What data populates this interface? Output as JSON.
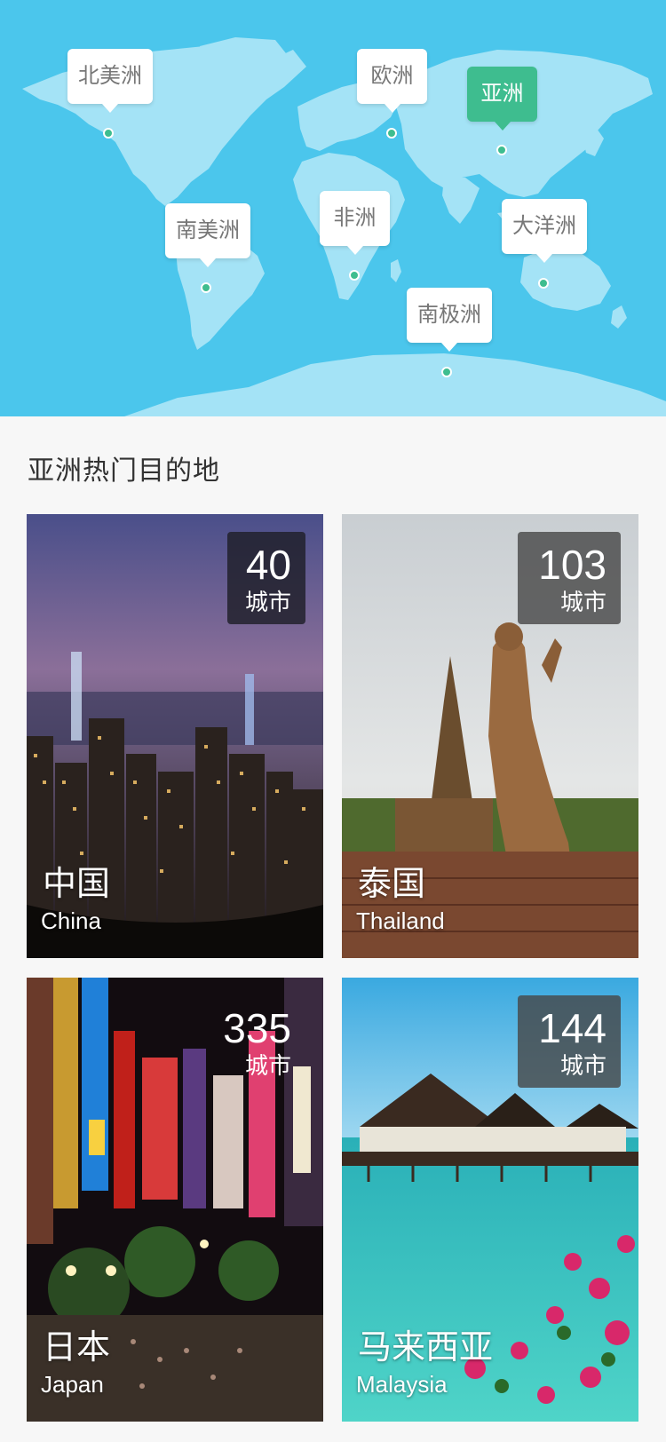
{
  "map": {
    "continents": [
      {
        "key": "north_america",
        "label": "北美洲",
        "active": false
      },
      {
        "key": "europe",
        "label": "欧洲",
        "active": false
      },
      {
        "key": "asia",
        "label": "亚洲",
        "active": true
      },
      {
        "key": "south_america",
        "label": "南美洲",
        "active": false
      },
      {
        "key": "africa",
        "label": "非洲",
        "active": false
      },
      {
        "key": "oceania",
        "label": "大洋洲",
        "active": false
      },
      {
        "key": "antarctica",
        "label": "南极洲",
        "active": false
      }
    ]
  },
  "section": {
    "title": "亚洲热门目的地"
  },
  "destinations": [
    {
      "name_cn": "中国",
      "name_en": "China",
      "count": "40",
      "unit": "城市"
    },
    {
      "name_cn": "泰国",
      "name_en": "Thailand",
      "count": "103",
      "unit": "城市"
    },
    {
      "name_cn": "日本",
      "name_en": "Japan",
      "count": "335",
      "unit": "城市"
    },
    {
      "name_cn": "马来西亚",
      "name_en": "Malaysia",
      "count": "144",
      "unit": "城市"
    }
  ],
  "colors": {
    "accent": "#3ebd8f",
    "map_ocean": "#4bc6ec",
    "map_land": "#a4e3f6"
  }
}
